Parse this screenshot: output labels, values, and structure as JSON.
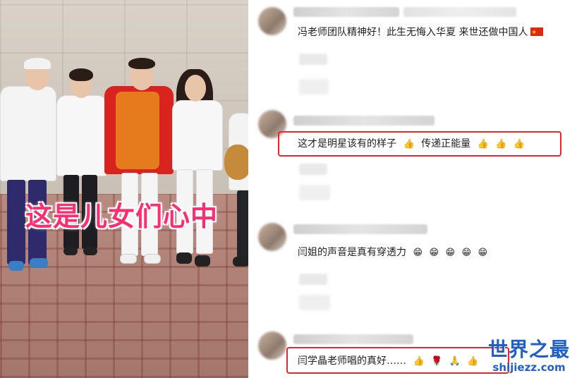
{
  "photo": {
    "caption": "这是儿女们心中"
  },
  "comments": [
    {
      "text": "冯老师团队精神好！此生无悔入华夏 来世还做中国人",
      "emojis": [],
      "flag": true,
      "highlighted": false
    },
    {
      "text": "这才是明星该有的样子",
      "emojis": [
        "👍",
        "传递正能量",
        "👍",
        "👍",
        "👍"
      ],
      "flag": false,
      "highlighted": true
    },
    {
      "text": "闫姐的声音是真有穿透力",
      "emojis": [
        "😁",
        "😁",
        "😁",
        "😁",
        "😁"
      ],
      "flag": false,
      "highlighted": false
    },
    {
      "text": "闫学晶老师唱的真好……",
      "emojis": [
        "👍",
        "🌹",
        "🙏",
        "👍"
      ],
      "flag": false,
      "highlighted": true
    }
  ],
  "watermark": {
    "title": "世界之最",
    "url": "shijiezz.com"
  },
  "colors": {
    "highlight": "#e8262b",
    "caption": "#ff2d6f",
    "watermark": "#1f5fc7"
  }
}
